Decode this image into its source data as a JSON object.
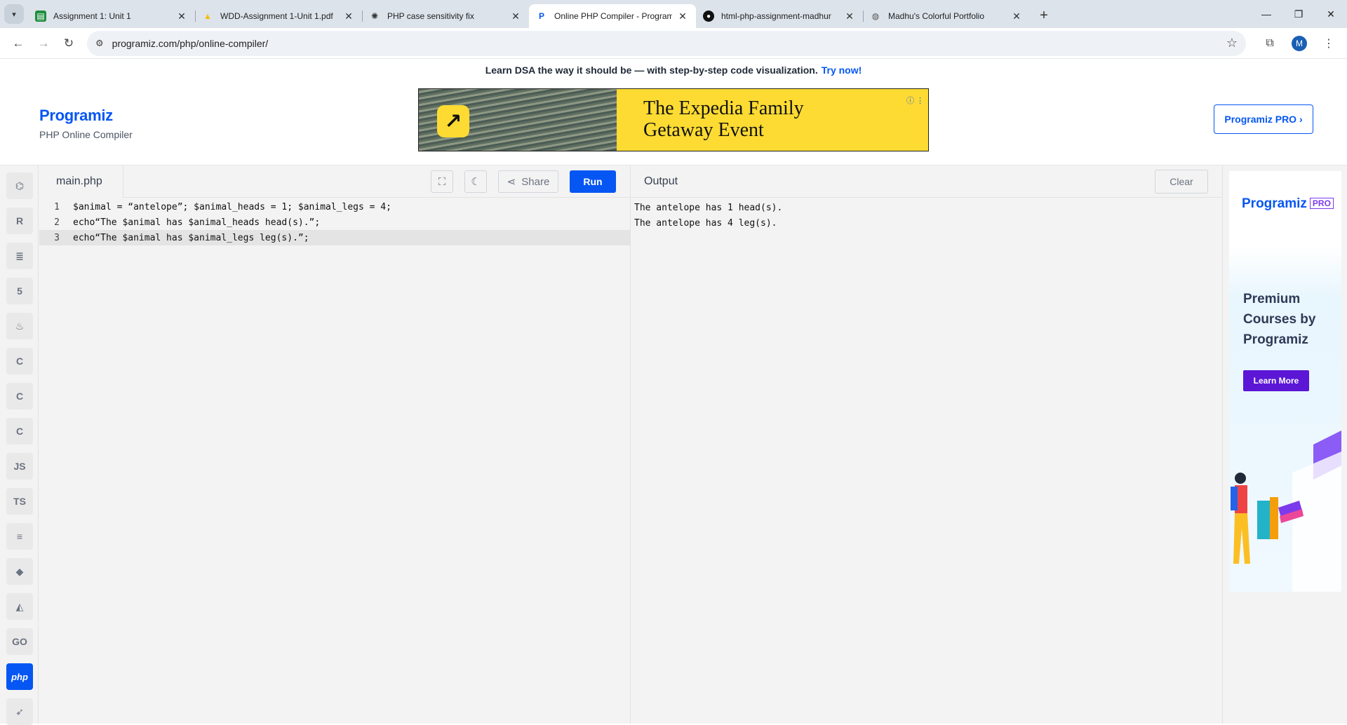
{
  "browser": {
    "tabs": [
      {
        "title": "Assignment 1: Unit 1",
        "icon": "classroom-icon",
        "color": "#1e8e3e"
      },
      {
        "title": "WDD-Assignment 1-Unit 1.pdf",
        "icon": "drive-icon",
        "color": "#fbbc04"
      },
      {
        "title": "PHP case sensitivity fix",
        "icon": "openai-icon",
        "color": "#333333"
      },
      {
        "title": "Online PHP Compiler - Program",
        "icon": "programiz-icon",
        "color": "#0556f3"
      },
      {
        "title": "html-php-assignment-madhur",
        "icon": "github-icon",
        "color": "#111111"
      },
      {
        "title": "Madhu's Colorful Portfolio",
        "icon": "globe-icon",
        "color": "#555555"
      }
    ],
    "url": "programiz.com/php/online-compiler/",
    "profile_initial": "M"
  },
  "promo": {
    "text": "Learn DSA the way it should be — with step-by-step code visualization.",
    "link": "Try now!"
  },
  "header": {
    "brand": "Programiz",
    "subtitle": "PHP Online Compiler",
    "pro_button": "Programiz PRO ›"
  },
  "ad_banner": {
    "line1": "The Expedia Family",
    "line2": "Getaway Event"
  },
  "languages": [
    {
      "icon": "python-icon",
      "label": ""
    },
    {
      "icon": "r-icon",
      "label": ""
    },
    {
      "icon": "sql-icon",
      "label": ""
    },
    {
      "icon": "html-icon",
      "label": ""
    },
    {
      "icon": "java-icon",
      "label": ""
    },
    {
      "icon": "c-icon",
      "label": ""
    },
    {
      "icon": "cpp-icon",
      "label": ""
    },
    {
      "icon": "csharp-icon",
      "label": ""
    },
    {
      "icon": "js-icon",
      "label": "JS"
    },
    {
      "icon": "ts-icon",
      "label": "TS"
    },
    {
      "icon": "kotlin-icon",
      "label": ""
    },
    {
      "icon": "ruby-icon",
      "label": ""
    },
    {
      "icon": "swift-icon",
      "label": ""
    },
    {
      "icon": "go-icon",
      "label": "GO"
    },
    {
      "icon": "php-icon",
      "label": "php"
    },
    {
      "icon": "rust-icon",
      "label": ""
    }
  ],
  "editor": {
    "filename": "main.php",
    "share_label": "Share",
    "run_label": "Run",
    "lines": [
      {
        "n": "1",
        "text": "$animal = “antelope”; $animal_heads = 1; $animal_legs = 4;"
      },
      {
        "n": "2",
        "text": "echo“The $animal has $animal_heads head(s).”;"
      },
      {
        "n": "3",
        "text": "echo“The $animal has $animal_legs leg(s).”;"
      }
    ]
  },
  "output": {
    "title": "Output",
    "clear_label": "Clear",
    "lines": [
      "The antelope has 1 head(s).",
      "The antelope has 4 leg(s)."
    ]
  },
  "side_ad": {
    "brand": "Programiz",
    "badge": "PRO",
    "headline_1": "Premium",
    "headline_2": "Courses by",
    "headline_3": "Programiz",
    "button": "Learn More"
  },
  "colors": {
    "accent": "#0556f3",
    "purple": "#5b16d6"
  }
}
